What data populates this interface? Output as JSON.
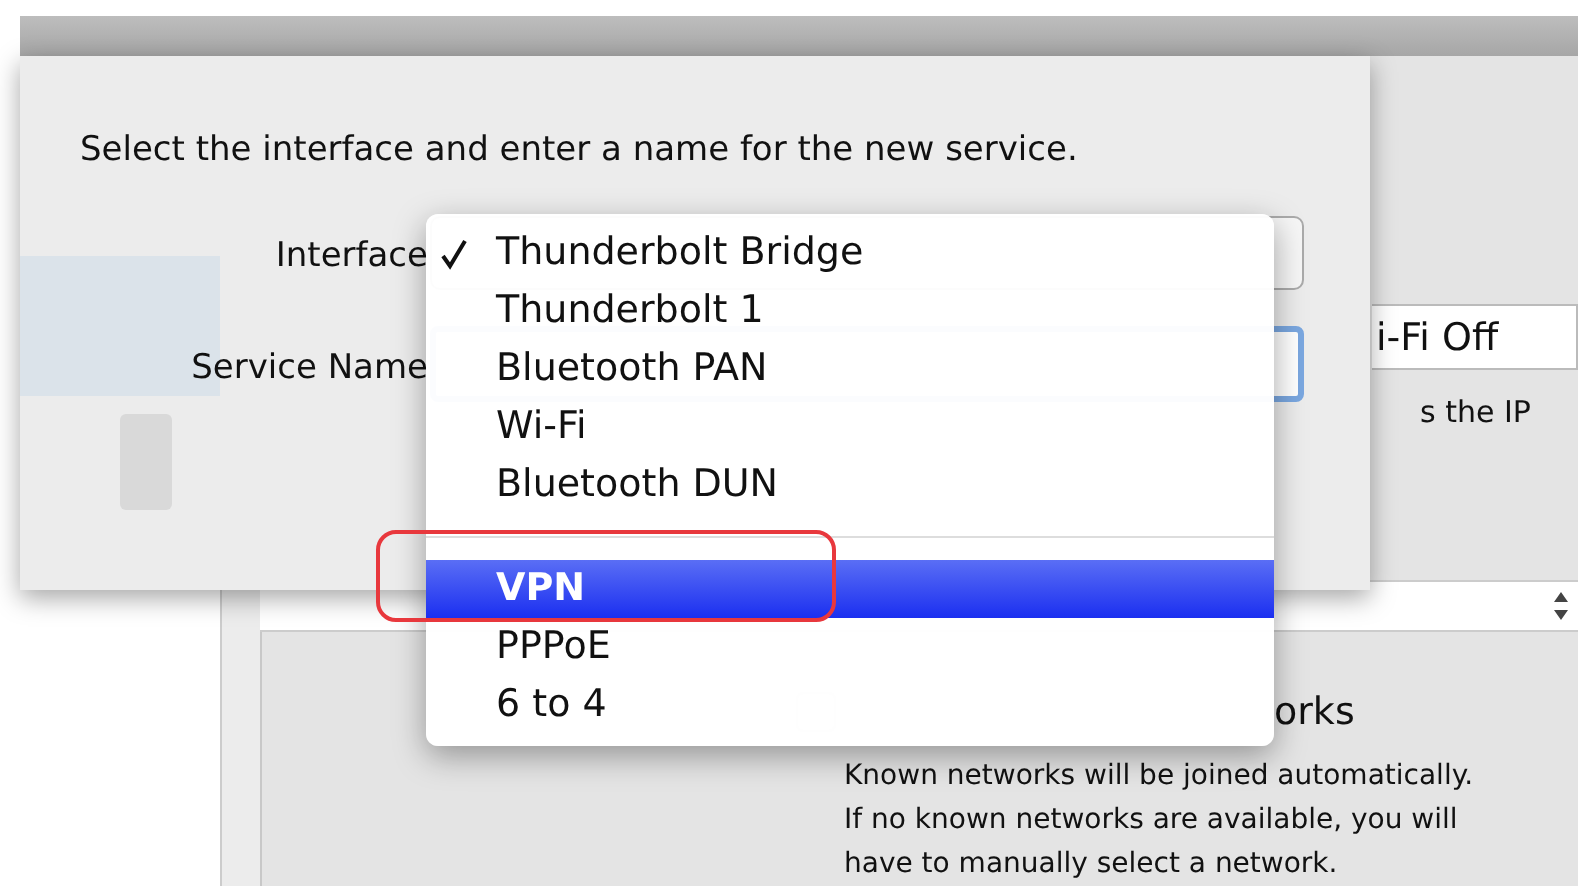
{
  "dialog": {
    "prompt": "Select the interface and enter a name for the new service.",
    "interface_label": "Interface",
    "service_name_label": "Service Name"
  },
  "interface_menu": {
    "items": [
      {
        "kind": "item",
        "label": "Thunderbolt Bridge",
        "checked": true,
        "selected": false
      },
      {
        "kind": "item",
        "label": "Thunderbolt 1",
        "checked": false,
        "selected": false
      },
      {
        "kind": "item",
        "label": "Bluetooth PAN",
        "checked": false,
        "selected": false
      },
      {
        "kind": "item",
        "label": "Wi-Fi",
        "checked": false,
        "selected": false
      },
      {
        "kind": "item",
        "label": "Bluetooth DUN",
        "checked": false,
        "selected": false
      },
      {
        "kind": "separator"
      },
      {
        "kind": "item",
        "label": "VPN",
        "checked": false,
        "selected": true
      },
      {
        "kind": "item",
        "label": "PPPoE",
        "checked": false,
        "selected": false
      },
      {
        "kind": "item",
        "label": "6 to 4",
        "checked": false,
        "selected": false
      }
    ]
  },
  "background": {
    "wifi_button": "i-Fi Off",
    "ip_text": "s the IP",
    "checkbox_label": "orks",
    "help_lines": [
      "Known networks will be joined automatically.",
      "If no known networks are available, you will",
      "have to manually select a network."
    ]
  }
}
